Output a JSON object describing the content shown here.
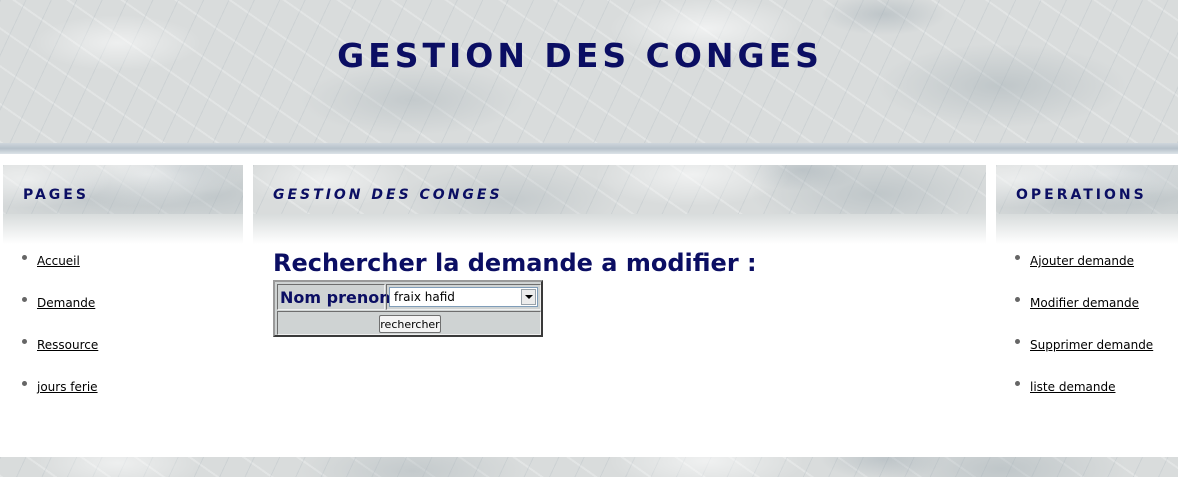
{
  "header": {
    "title": "GESTION DES CONGES"
  },
  "left_panel": {
    "title": "PAGES",
    "items": [
      {
        "label": "Accueil"
      },
      {
        "label": "Demande"
      },
      {
        "label": "Ressource"
      },
      {
        "label": "jours ferie"
      }
    ]
  },
  "center_panel": {
    "title": "GESTION DES CONGES",
    "heading": "Rechercher la demande a modifier :",
    "form": {
      "field_label": "Nom prenom",
      "selected_value": "fraix hafid",
      "button_label": "rechercher"
    }
  },
  "right_panel": {
    "title": "OPERATIONS",
    "items": [
      {
        "label": "Ajouter demande"
      },
      {
        "label": "Modifier demande"
      },
      {
        "label": "Supprimer demande"
      },
      {
        "label": "liste demande"
      }
    ]
  },
  "colors": {
    "title_navy": "#0b0e63",
    "marble_base": "#d9dcdc",
    "link": "#000000"
  }
}
